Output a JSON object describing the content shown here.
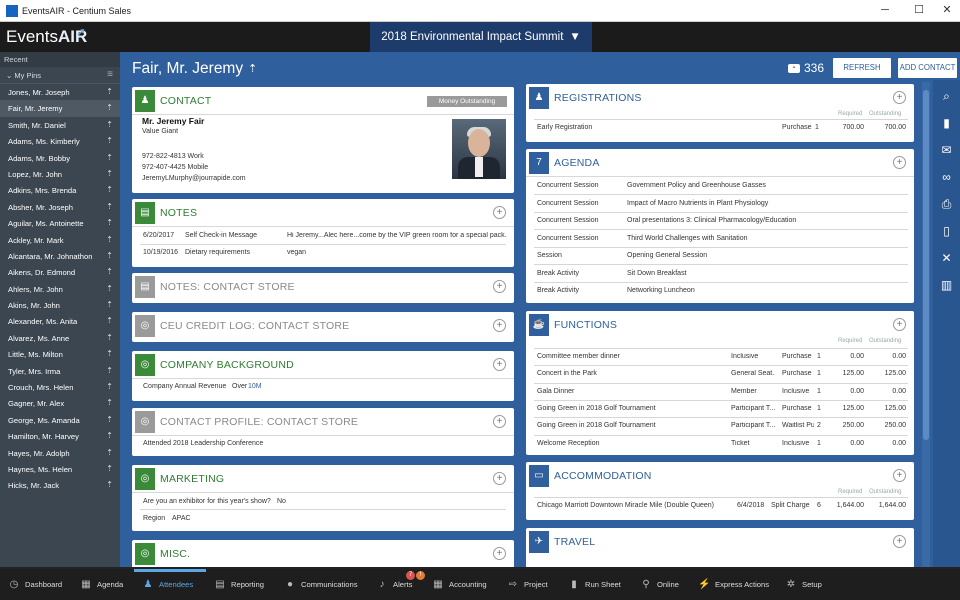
{
  "window": {
    "title": "EventsAIR - Centium Sales"
  },
  "brand": {
    "name_1": "Events",
    "name_2": "AIR"
  },
  "event_selector": {
    "label": "2018 Environmental Impact Summit"
  },
  "sidebar": {
    "recent_label": "Recent",
    "pins_label": "My Pins",
    "items": [
      "Jones, Mr. Joseph",
      "Fair, Mr. Jeremy",
      "Smith, Mr. Daniel",
      "Adams, Ms. Kimberly",
      "Adams, Mr. Bobby",
      "Lopez, Mr. John",
      "Adkins, Mrs. Brenda",
      "Absher, Mr. Joseph",
      "Aguilar, Ms. Antoinette",
      "Ackley, Mr. Mark",
      "Alcantara, Mr. Johnathon",
      "Aikens, Dr. Edmond",
      "Ahlers, Mr. John",
      "Akins, Mr. John",
      "Alexander, Ms. Anita",
      "Alvarez, Ms. Anne",
      "Little, Ms. Milton",
      "Tyler, Mrs. Irma",
      "Crouch, Mrs. Helen",
      "Gagner, Mr. Alex",
      "George, Ms. Amanda",
      "Hamilton, Mr. Harvey",
      "Hayes, Mr. Adolph",
      "Haynes, Ms. Helen",
      "Hicks, Mr. Jack"
    ]
  },
  "header": {
    "contact_name": "Fair, Mr. Jeremy",
    "count": "336",
    "refresh": "REFRESH",
    "add_contact": "ADD CONTACT"
  },
  "contact": {
    "title": "CONTACT",
    "status": "Money Outstanding",
    "name": "Mr. Jeremy Fair",
    "company": "Value Giant",
    "phone_work": "972-822-4813 Work",
    "phone_mobile": "972-407-4425 Mobile",
    "email": "JeremyLMurphy@jourrapide.com"
  },
  "notes": {
    "title": "NOTES",
    "rows": [
      {
        "date": "6/20/2017",
        "type": "Self Check-in Message",
        "text": "Hi Jeremy...Alec here...come by the VIP green room for a special pack..."
      },
      {
        "date": "10/19/2016",
        "type": "Dietary requirements",
        "text": "vegan"
      }
    ]
  },
  "notes_store": {
    "title": "NOTES: CONTACT STORE"
  },
  "ceu": {
    "title": "CEU CREDIT LOG: CONTACT STORE"
  },
  "company_bg": {
    "title": "COMPANY BACKGROUND",
    "label": "Company Annual Revenue",
    "value_prefix": "Over",
    "value_link": "10M"
  },
  "contact_profile": {
    "title": "CONTACT PROFILE: CONTACT STORE",
    "text": "Attended 2018 Leadership Conference"
  },
  "marketing": {
    "title": "MARKETING",
    "q1": "Are you an exhibitor for this year's show?",
    "a1": "No",
    "q2": "Region",
    "a2": "APAC"
  },
  "misc": {
    "title": "MISC."
  },
  "registrations": {
    "title": "REGISTRATIONS",
    "col_required": "Required",
    "col_outstanding": "Outstanding",
    "rows": [
      {
        "name": "Early Registration",
        "status": "Purchase",
        "qty": "1",
        "required": "700.00",
        "outstanding": "700.00"
      }
    ]
  },
  "agenda": {
    "title": "AGENDA",
    "rows": [
      {
        "type": "Concurrent Session",
        "name": "Government Policy and Greenhouse Gasses"
      },
      {
        "type": "Concurrent Session",
        "name": "Impact of Macro Nutrients in Plant Physiology"
      },
      {
        "type": "Concurrent Session",
        "name": "Oral presentations 3: Clinical Pharmacology/Education"
      },
      {
        "type": "Concurrent Session",
        "name": "Third World Challenges with Sanitation"
      },
      {
        "type": "Session",
        "name": "Opening General Session"
      },
      {
        "type": "Break Activity",
        "name": "Sit Down Breakfast"
      },
      {
        "type": "Break Activity",
        "name": "Networking Luncheon"
      }
    ]
  },
  "functions": {
    "title": "FUNCTIONS",
    "col_required": "Required",
    "col_outstanding": "Outstanding",
    "rows": [
      {
        "name": "Committee member dinner",
        "cat": "Inclusive",
        "status": "Purchase",
        "qty": "1",
        "required": "0.00",
        "outstanding": "0.00"
      },
      {
        "name": "Concert in the Park",
        "cat": "General Seat...",
        "status": "Purchase",
        "qty": "1",
        "required": "125.00",
        "outstanding": "125.00"
      },
      {
        "name": "Gala Dinner",
        "cat": "Member",
        "status": "Inclusive",
        "qty": "1",
        "required": "0.00",
        "outstanding": "0.00"
      },
      {
        "name": "Going Green in 2018 Golf Tournament",
        "cat": "Participant T...",
        "status": "Purchase",
        "qty": "1",
        "required": "125.00",
        "outstanding": "125.00"
      },
      {
        "name": "Going Green in 2018 Golf Tournament",
        "cat": "Participant T...",
        "status": "Waitlist Pur...",
        "qty": "2",
        "required": "250.00",
        "outstanding": "250.00"
      },
      {
        "name": "Welcome Reception",
        "cat": "Ticket",
        "status": "Inclusive",
        "qty": "1",
        "required": "0.00",
        "outstanding": "0.00"
      }
    ]
  },
  "accommodation": {
    "title": "ACCOMMODATION",
    "col_required": "Required",
    "col_outstanding": "Outstanding",
    "rows": [
      {
        "name": "Chicago Marriott Downtown Miracle Mile (Double Queen)",
        "date": "6/4/2018",
        "status": "Split Charge",
        "qty": "6",
        "required": "1,644.00",
        "outstanding": "1,644.00"
      }
    ]
  },
  "travel": {
    "title": "TRAVEL"
  },
  "bottom_nav": [
    {
      "label": "Dashboard",
      "icon": "dashboard-icon"
    },
    {
      "label": "Agenda",
      "icon": "calendar-icon"
    },
    {
      "label": "Attendees",
      "icon": "people-icon"
    },
    {
      "label": "Reporting",
      "icon": "report-icon"
    },
    {
      "label": "Communications",
      "icon": "chat-icon"
    },
    {
      "label": "Alerts",
      "icon": "bell-icon"
    },
    {
      "label": "Accounting",
      "icon": "accounting-icon"
    },
    {
      "label": "Project",
      "icon": "project-icon"
    },
    {
      "label": "Run Sheet",
      "icon": "runsheet-icon"
    },
    {
      "label": "Online",
      "icon": "online-icon"
    },
    {
      "label": "Express Actions",
      "icon": "bolt-icon"
    },
    {
      "label": "Setup",
      "icon": "gear-icon"
    }
  ],
  "alerts_badges": {
    "a": "7",
    "b": "!"
  },
  "colors": {
    "primary": "#2f5f9c",
    "green": "#2e7d32",
    "dark": "#1b1b1b",
    "accent": "#5aa8e8"
  }
}
